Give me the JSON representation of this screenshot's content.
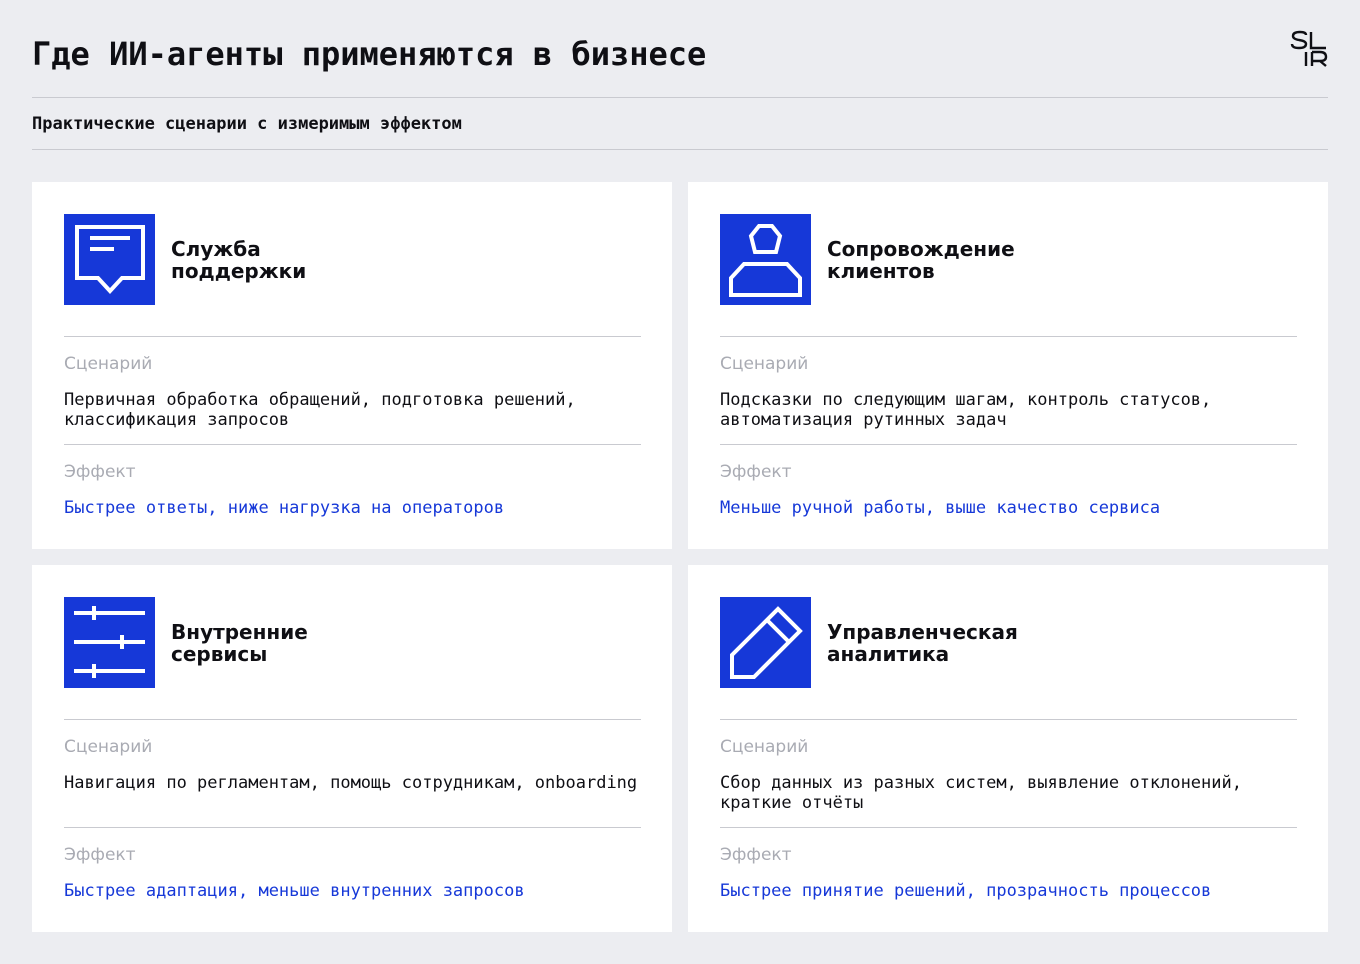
{
  "header": {
    "title": "Где ИИ-агенты применяются в бизнесе",
    "subtitle": "Практические сценарии с измеримым эффектом",
    "logo_text": "SLR"
  },
  "colors": {
    "background": "#ecedf1",
    "accent": "#1638d8",
    "card": "#ffffff",
    "muted": "#a9abb3"
  },
  "cards": [
    {
      "icon": "chat-message-icon",
      "title": "Служба\nподдержки",
      "scenario_label": "Сценарий",
      "scenario": "Первичная обработка обращений, подготовка решений, классификация запросов",
      "effect_label": "Эффект",
      "effect": "Быстрее ответы, ниже нагрузка на операторов"
    },
    {
      "icon": "user-icon",
      "title": "Сопровождение\nклиентов",
      "scenario_label": "Сценарий",
      "scenario": "Подсказки по следующим шагам, контроль статусов, автоматизация рутинных задач",
      "effect_label": "Эффект",
      "effect": "Меньше ручной работы, выше качество сервиса"
    },
    {
      "icon": "sliders-icon",
      "title": "Внутренние\nсервисы",
      "scenario_label": "Сценарий",
      "scenario": "Навигация по регламентам, помощь сотрудникам, onboarding",
      "effect_label": "Эффект",
      "effect": "Быстрее адаптация, меньше внутренних запросов"
    },
    {
      "icon": "pencil-icon",
      "title": "Управленческая\nаналитика",
      "scenario_label": "Сценарий",
      "scenario": "Сбор данных из разных систем, выявление отклонений, краткие отчёты",
      "effect_label": "Эффект",
      "effect": "Быстрее принятие решений, прозрачность процессов"
    }
  ]
}
